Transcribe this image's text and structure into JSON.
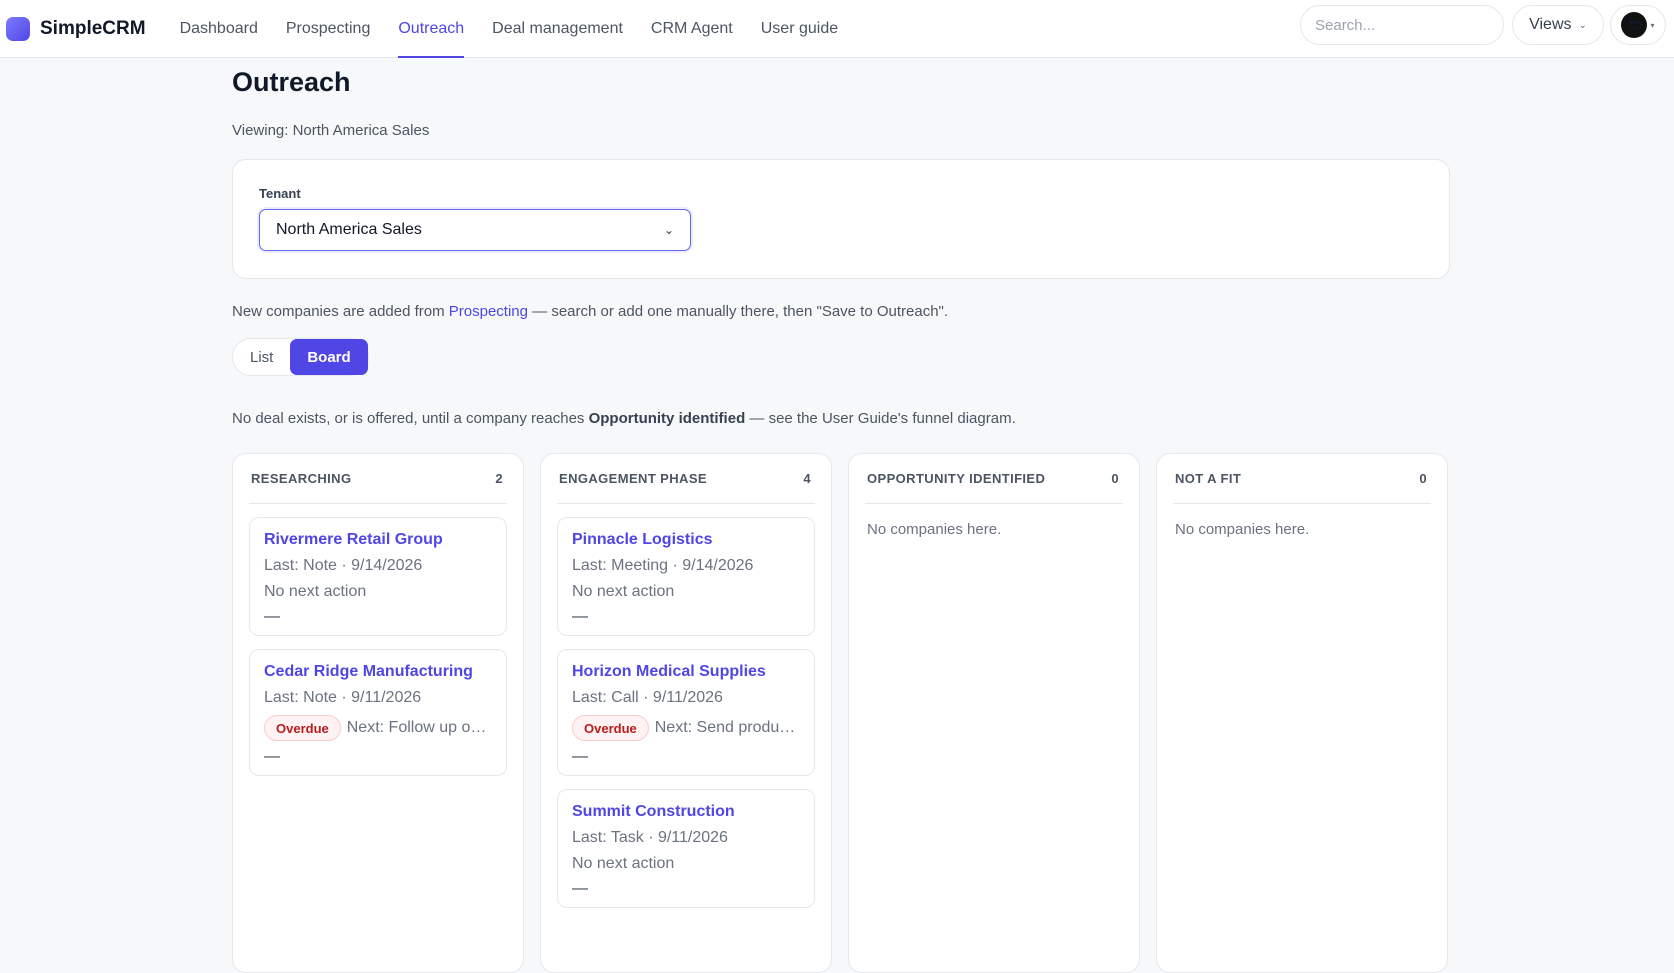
{
  "app": {
    "name": "SimpleCRM"
  },
  "nav": {
    "items": [
      {
        "label": "Dashboard"
      },
      {
        "label": "Prospecting"
      },
      {
        "label": "Outreach"
      },
      {
        "label": "Deal management"
      },
      {
        "label": "CRM Agent"
      },
      {
        "label": "User guide"
      }
    ],
    "active": "Outreach"
  },
  "header": {
    "search_placeholder": "Search...",
    "views_label": "Views",
    "avatar_icon": "sunglasses-face-icon"
  },
  "page": {
    "title": "Outreach",
    "viewing": "Viewing: North America Sales",
    "tenant_label": "Tenant",
    "tenant_value": "North America Sales",
    "info_prefix": "New companies are added from ",
    "info_link": "Prospecting",
    "info_suffix": " — search or add one manually there, then \"Save to Outreach\".",
    "view_toggle": {
      "list": "List",
      "board": "Board",
      "selected": "Board"
    },
    "note_prefix": "No deal exists, or is offered, until a company reaches ",
    "note_bold": "Opportunity identified",
    "note_suffix": " — see the User Guide's funnel diagram."
  },
  "board": {
    "empty_text": "No companies here.",
    "columns": [
      {
        "title": "RESEARCHING",
        "count": "2",
        "cards": [
          {
            "name": "Rivermere Retail Group",
            "last": "Last: Note · 9/14/2026",
            "next": "No next action",
            "overdue": false,
            "dash": "—"
          },
          {
            "name": "Cedar Ridge Manufacturing",
            "last": "Last: Note · 9/11/2026",
            "next": "Next: Follow up on i...",
            "overdue": true,
            "badge": "Overdue",
            "dash": "—"
          }
        ]
      },
      {
        "title": "ENGAGEMENT PHASE",
        "count": "4",
        "cards": [
          {
            "name": "Pinnacle Logistics",
            "last": "Last: Meeting · 9/14/2026",
            "next": "No next action",
            "overdue": false,
            "dash": "—"
          },
          {
            "name": "Horizon Medical Supplies",
            "last": "Last: Call · 9/11/2026",
            "next": "Next: Send product...",
            "overdue": true,
            "badge": "Overdue",
            "dash": "—"
          },
          {
            "name": "Summit Construction",
            "last": "Last: Task · 9/11/2026",
            "next": "No next action",
            "overdue": false,
            "dash": "—"
          }
        ]
      },
      {
        "title": "OPPORTUNITY IDENTIFIED",
        "count": "0",
        "cards": []
      },
      {
        "title": "NOT A FIT",
        "count": "0",
        "cards": []
      }
    ]
  },
  "colors": {
    "accent": "#4f46e5",
    "overdue": "#b91c1c",
    "background": "#f7f8fa"
  }
}
